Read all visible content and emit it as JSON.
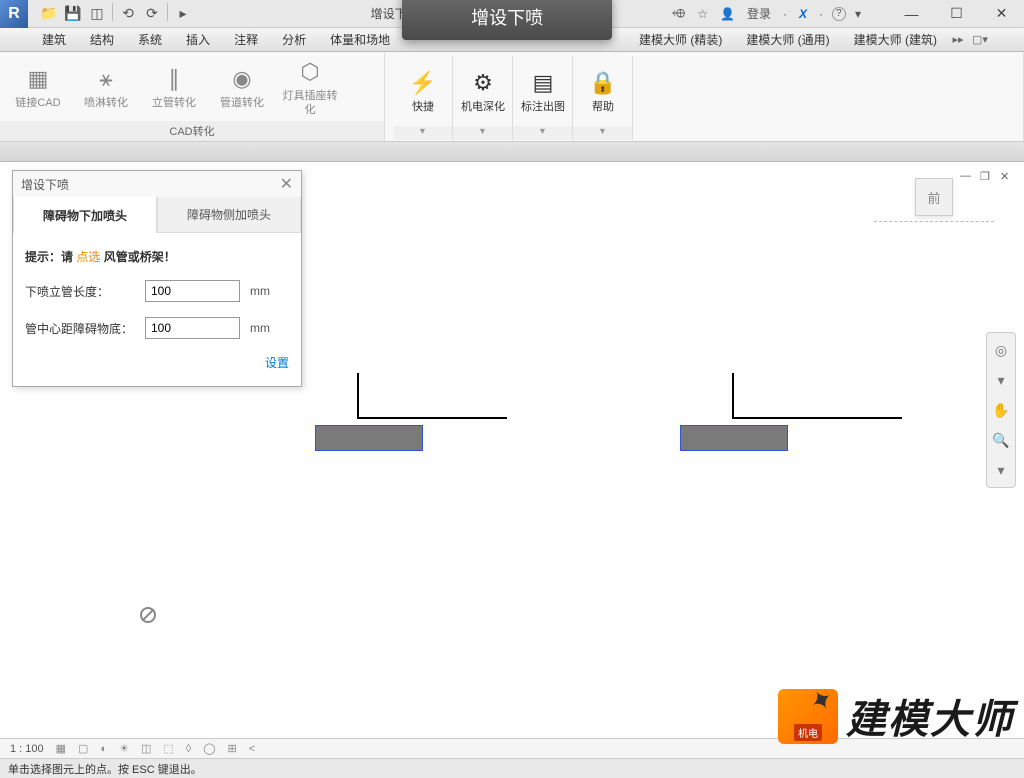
{
  "title": "增设下喷_精确比障碍…",
  "qat": [
    "📁",
    "💾",
    "◫",
    "⟲",
    "⟳",
    "▸"
  ],
  "login": "登录",
  "help_icon": "?",
  "x_icon": "✕",
  "menu": [
    "建筑",
    "结构",
    "系统",
    "插入",
    "注释",
    "分析",
    "体量和场地"
  ],
  "menu_right": [
    "建模大师 (精装)",
    "建模大师 (通用)",
    "建模大师 (建筑)"
  ],
  "ribbon": {
    "panel1": {
      "label": "CAD转化",
      "btns": [
        {
          "icon": "▦",
          "label": "链接CAD"
        },
        {
          "icon": "⚹",
          "label": "喷淋转化"
        },
        {
          "icon": "∥",
          "label": "立管转化"
        },
        {
          "icon": "◉",
          "label": "管道转化"
        },
        {
          "icon": "⬡",
          "label": "灯具插座转化"
        }
      ]
    },
    "panel2": {
      "btns": [
        {
          "icon": "⚡",
          "label": "快捷"
        },
        {
          "icon": "⚙",
          "label": "机电深化"
        },
        {
          "icon": "▤",
          "label": "标注出图"
        },
        {
          "icon": "🔒",
          "label": "帮助"
        }
      ]
    }
  },
  "tooltip": "增设下喷",
  "dialog": {
    "title": "增设下喷",
    "tab1": "障碍物下加喷头",
    "tab2": "障碍物侧加喷头",
    "hint_prefix": "提示：请 ",
    "hint_link": "点选",
    "hint_suffix": " 风管或桥架！",
    "field1_label": "下喷立管长度：",
    "field1_value": "100",
    "field2_label": "管中心距障碍物底：",
    "field2_value": "100",
    "unit": "mm",
    "settings": "设置"
  },
  "view_cube": "前",
  "view_status": {
    "scale": "1 : 100",
    "icons": [
      "▦",
      "▢",
      "◐",
      "☀",
      "◫",
      "⬚",
      "◊",
      "◯",
      "⊞",
      "<"
    ]
  },
  "statusbar": "单击选择图元上的点。按 ESC 键退出。",
  "watermark": {
    "badge": "机电",
    "text": "建模大师"
  }
}
